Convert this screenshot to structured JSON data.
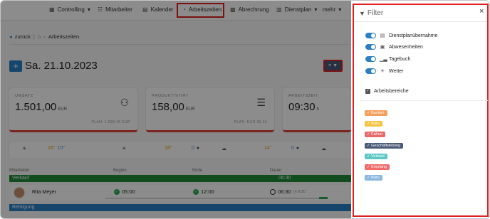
{
  "nav": {
    "items": [
      {
        "label": "Controlling",
        "icon": "chart-icon",
        "dropdown": true
      },
      {
        "label": "Mitarbeiter",
        "icon": "users-icon",
        "dropdown": false
      },
      {
        "label": "Kalender",
        "icon": "calendar-icon",
        "dropdown": false
      },
      {
        "label": "Arbeitszeiten",
        "icon": "stopwatch-icon",
        "dropdown": false
      },
      {
        "label": "Abrechnung",
        "icon": "grid-icon",
        "dropdown": false
      },
      {
        "label": "Dienstplan",
        "icon": "schedule-icon",
        "dropdown": true
      },
      {
        "label": "mehr",
        "icon": "",
        "dropdown": true
      }
    ],
    "active": "Arbeitszeiten"
  },
  "breadcrumb": {
    "back": "zurück",
    "current": "Arbeitszeiten"
  },
  "page": {
    "date": "Sa. 21.10.2023"
  },
  "kpis": [
    {
      "label": "UMSATZ",
      "value": "1.501,00",
      "unit": "EUR",
      "plan": "PLAN: 1.698,45 EUR"
    },
    {
      "label": "PRODUKTIVITÄT",
      "value": "158,00",
      "unit": "EUR",
      "plan": "PLAN: EUR 66,13"
    },
    {
      "label": "ARBEITSZEIT",
      "value": "09:30",
      "unit": "h",
      "plan": ""
    }
  ],
  "weather": [
    {
      "hi": "16°",
      "lo": "10°"
    },
    {
      "hi": "18°",
      "lo": "0"
    },
    {
      "hi": "14°",
      "lo": "0"
    },
    {
      "hi": "",
      "lo": ""
    }
  ],
  "table": {
    "headers": [
      "Mitarbeiter",
      "Beginn",
      "Ende",
      "Dauer"
    ],
    "groups": [
      {
        "name": "Verkauf",
        "time": "06:30",
        "color": "#1f8a3a"
      },
      {
        "name": "Reinigung",
        "time": "",
        "color": "#2b80c5"
      }
    ],
    "rows": [
      {
        "name": "Rita Meyer",
        "start": "05:00",
        "end": "12:00",
        "duration": "06:30",
        "break": "0:30"
      }
    ]
  },
  "filter": {
    "title": "Filter",
    "close": "×",
    "toggles": [
      {
        "label": "Dienstplanübernahme",
        "icon": "calendar-icon",
        "on": true
      },
      {
        "label": "Abwesenheiten",
        "icon": "calendar-x-icon",
        "on": true
      },
      {
        "label": "Tagebuch",
        "icon": "chart-icon",
        "on": true
      },
      {
        "label": "Wetter",
        "icon": "sun-icon",
        "on": true
      }
    ],
    "areas_label": "Arbeitsbereiche",
    "areas": [
      {
        "label": "Backen",
        "color": "#f5a05c"
      },
      {
        "label": "Büro",
        "color": "#f5c542"
      },
      {
        "label": "Fahrer",
        "color": "#e86b6b"
      },
      {
        "label": "Geschäftsleitung",
        "color": "#4a5a78"
      },
      {
        "label": "Verkauf",
        "color": "#5ec9c4"
      },
      {
        "label": "Empfang",
        "color": "#f06a6a"
      },
      {
        "label": "Büro",
        "color": "#8bb8e0"
      }
    ]
  }
}
